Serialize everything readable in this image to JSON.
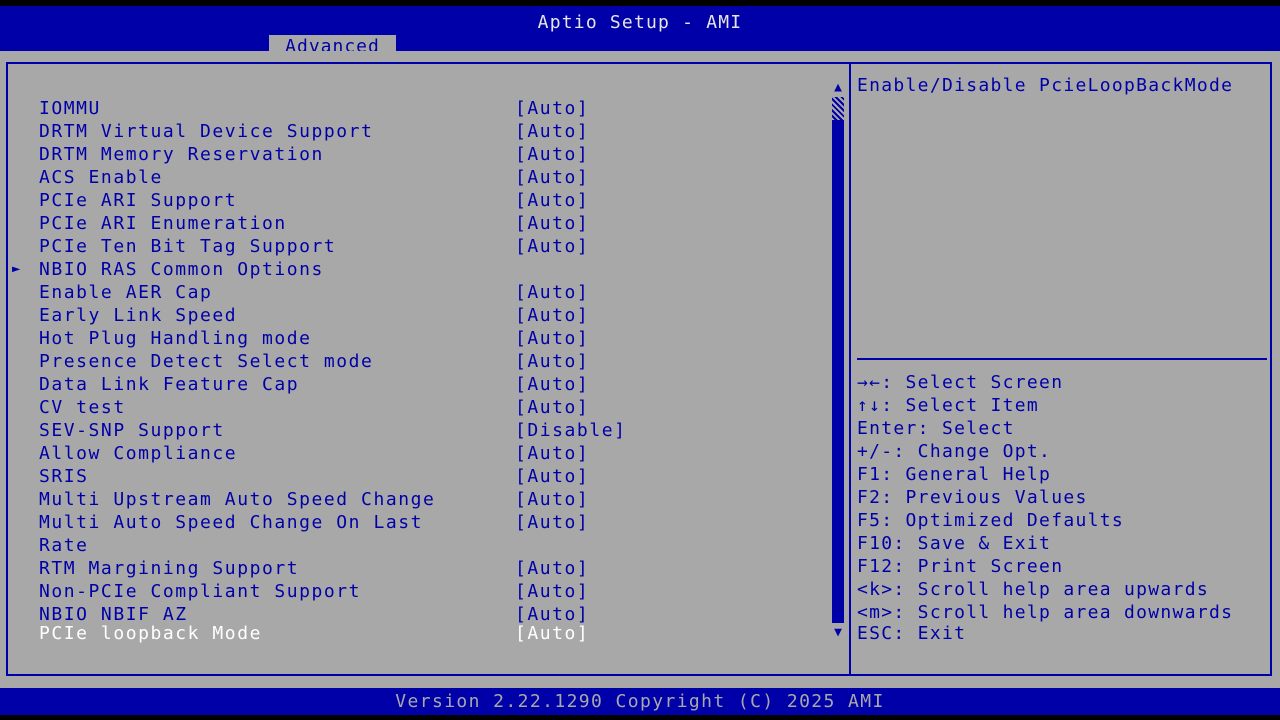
{
  "header": {
    "title": "Aptio Setup - AMI",
    "active_tab": "Advanced"
  },
  "settings": [
    {
      "label": "IOMMU",
      "value": "[Auto]"
    },
    {
      "label": "DRTM Virtual Device Support",
      "value": "[Auto]"
    },
    {
      "label": "DRTM Memory Reservation",
      "value": "[Auto]"
    },
    {
      "label": "ACS Enable",
      "value": "[Auto]"
    },
    {
      "label": "PCIe ARI Support",
      "value": "[Auto]"
    },
    {
      "label": "PCIe ARI Enumeration",
      "value": "[Auto]"
    },
    {
      "label": "PCIe Ten Bit Tag Support",
      "value": "[Auto]"
    },
    {
      "label": "NBIO RAS Common Options",
      "value": ""
    },
    {
      "label": "Enable AER Cap",
      "value": "[Auto]"
    },
    {
      "label": "Early Link Speed",
      "value": "[Auto]"
    },
    {
      "label": "Hot Plug Handling mode",
      "value": "[Auto]"
    },
    {
      "label": "Presence Detect Select mode",
      "value": "[Auto]"
    },
    {
      "label": "Data Link Feature Cap",
      "value": "[Auto]"
    },
    {
      "label": "CV test",
      "value": "[Auto]"
    },
    {
      "label": "SEV-SNP Support",
      "value": "[Disable]"
    },
    {
      "label": "Allow Compliance",
      "value": "[Auto]"
    },
    {
      "label": "SRIS",
      "value": "[Auto]"
    },
    {
      "label": "Multi Upstream Auto Speed Change",
      "value": "[Auto]"
    },
    {
      "label": "Multi Auto Speed Change On Last",
      "value": "[Auto]"
    },
    {
      "label": "Rate",
      "value": ""
    },
    {
      "label": "RTM Margining Support",
      "value": "[Auto]"
    },
    {
      "label": "Non-PCIe Compliant Support",
      "value": "[Auto]"
    },
    {
      "label": "NBIO NBIF AZ",
      "value": "[Auto]"
    },
    {
      "label": "PCIe loopback Mode",
      "value": "[Auto]"
    }
  ],
  "submenu_arrow": "►",
  "scroll": {
    "up": "▲",
    "down": "▼"
  },
  "help": {
    "text": "Enable/Disable PcieLoopBackMode"
  },
  "keys": [
    "→←: Select Screen",
    "↑↓: Select Item",
    "Enter: Select",
    "+/-: Change Opt.",
    "F1: General Help",
    "F2: Previous Values",
    "F5: Optimized Defaults",
    "F10: Save & Exit",
    "F12: Print Screen",
    "<k>: Scroll help area upwards",
    "<m>: Scroll help area downwards",
    "ESC: Exit"
  ],
  "footer": {
    "version": "Version 2.22.1290 Copyright (C) 2025 AMI"
  },
  "colors": {
    "background": "#a8a8a8",
    "accent": "#0000a8",
    "highlight_text": "#ffffff"
  }
}
